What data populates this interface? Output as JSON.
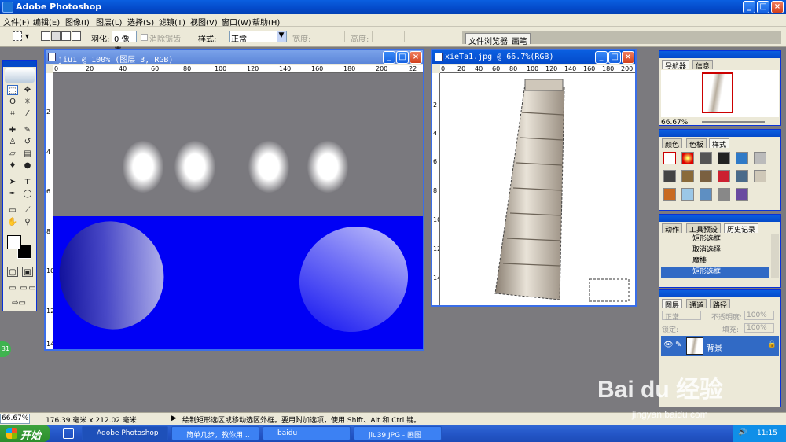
{
  "app": {
    "title": "Adobe Photoshop",
    "window_buttons": [
      "_",
      "□",
      "×"
    ]
  },
  "menu": [
    "文件(F)",
    "编辑(E)",
    "图像(I)",
    "图层(L)",
    "选择(S)",
    "滤镜(T)",
    "视图(V)",
    "窗口(W)",
    "帮助(H)"
  ],
  "options": {
    "feather_label": "羽化:",
    "feather_value": "0 像素",
    "antialias_label": "消除锯齿",
    "style_label": "样式:",
    "style_value": "正常",
    "width_label": "宽度:",
    "height_label": "高度:",
    "well_tabs": [
      "文件浏览器",
      "画笔"
    ]
  },
  "toolbox": {
    "badge": "31"
  },
  "doc1": {
    "title": "jiu1 @ 100% (图层 3, RGB)",
    "ruler_h": [
      "0",
      "20",
      "40",
      "60",
      "80",
      "100",
      "120",
      "140",
      "160",
      "180",
      "200",
      "22"
    ],
    "ruler_v": [
      "2",
      "4",
      "6",
      "8",
      "10",
      "12",
      "14"
    ],
    "colors": {
      "top": "#7a797e",
      "bottom": "#0000f5"
    }
  },
  "doc2": {
    "title": "xieTa1.jpg @ 66.7%(RGB)",
    "ruler_h": [
      "0",
      "20",
      "40",
      "60",
      "80",
      "100",
      "120",
      "140",
      "160",
      "180",
      "200"
    ],
    "ruler_v": [
      "2",
      "4",
      "6",
      "8",
      "10",
      "12",
      "14"
    ]
  },
  "navigator": {
    "tabs": [
      "导航器",
      "信息"
    ],
    "zoom": "66.67%"
  },
  "swatches": {
    "tabs": [
      "颜色",
      "色板",
      "样式"
    ]
  },
  "history": {
    "tabs": [
      "动作",
      "工具预设",
      "历史记录"
    ],
    "items": [
      "矩形选框",
      "取消选择",
      "魔棒",
      "矩形选框"
    ],
    "selected_index": 3
  },
  "layers": {
    "tabs": [
      "图层",
      "通道",
      "路径"
    ],
    "mode": "正常",
    "opacity_label": "不透明度:",
    "opacity_value": "100%",
    "lock_label": "锁定:",
    "fill_label": "填充:",
    "fill_value": "100%",
    "layer_name": "背景"
  },
  "status": {
    "zoom": "66.67%",
    "size": "176.39 毫米 x 212.02 毫米",
    "hint": "绘制矩形选区或移动选区外框。要用附加选项，使用 Shift、Alt 和 Ctrl 键。"
  },
  "taskbar": {
    "start": "开始",
    "tasks": [
      "Adobe Photoshop",
      "简单几步，教你用...",
      "baidu",
      "jiu39.JPG - 画图"
    ],
    "clock": "11:15"
  },
  "watermark": {
    "text": "Bai du 经验",
    "url": "jingyan.baidu.com"
  }
}
